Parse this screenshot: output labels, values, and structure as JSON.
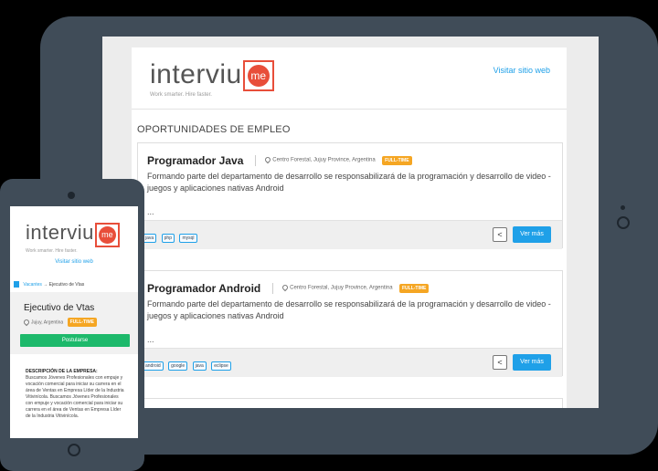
{
  "tablet": {
    "brand": {
      "word": "interviu",
      "mark": "me",
      "tagline": "Work smarter. Hire faster."
    },
    "visit_link": "Visitar sitio web",
    "section_title": "OPORTUNIDADES DE EMPLEO",
    "jobs": [
      {
        "title": "Programador Java",
        "location": "Centro Forestal, Jujuy Province, Argentina",
        "badge": "FULL-TIME",
        "description": "Formando parte del departamento de desarrollo se responsabilizará de la programación y desarrollo de video -juegos y aplicaciones nativas Android",
        "ellipsis": "...",
        "tags": [
          "java",
          "php",
          "mysql"
        ],
        "more_label": "Ver más"
      },
      {
        "title": "Programador Android",
        "location": "Centro Forestal, Jujuy Province, Argentina",
        "badge": "FULL-TIME",
        "description": "Formando parte del departamento de desarrollo se responsabilizará de la programación y desarrollo de video -juegos y aplicaciones nativas Android",
        "ellipsis": "...",
        "tags": [
          "android",
          "google",
          "java",
          "eclipse"
        ],
        "more_label": "Ver más"
      }
    ]
  },
  "phone": {
    "brand": {
      "word": "interviu",
      "mark": "me",
      "tagline": "Work smarter. Hire faster."
    },
    "visit_link": "Visitar sitio web",
    "breadcrumb": {
      "link": "Vacantes",
      "arrow": "→",
      "current": "Ejecutivo de Vtas"
    },
    "job_title": "Ejecutivo de Vtas",
    "location": "Jujuy, Argentina",
    "badge": "FULL-TIME",
    "apply_label": "Postularse",
    "desc_heading": "DESCRIPCIÓN DE LA EMPRESA:",
    "desc_body": "Buscamos Jóvenes Profesionales con empuje y vocación comercial para iniciar su carrera en el área de Ventas en Empresa Líder de la Industria Vitivinícola. Buscamos Jóvenes Profesionales con empuje y vocación comercial para iniciar su carrera en el área de Ventas en Empresa Líder de la Industria Vitivinícola."
  },
  "colors": {
    "accent": "#1fa0e8",
    "brand": "#e84e3a",
    "badge": "#f5a623",
    "apply": "#1db96b",
    "device": "#404c58"
  }
}
